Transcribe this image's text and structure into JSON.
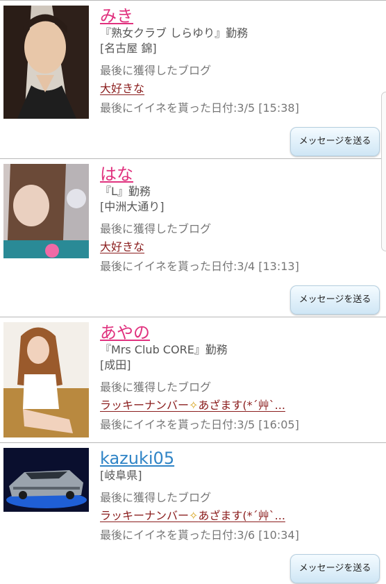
{
  "users": [
    {
      "name": "みき",
      "workplace": "『熟女クラブ しらゆり』勤務",
      "area": "[名古屋 錦]",
      "blog_heading": "最後に獲得したブログ",
      "blog_title": "大好きな",
      "like_date": "最後にイイネを貰った日付:3/5 [15:38]",
      "message_label": "メッセージを送る"
    },
    {
      "name": "はな",
      "workplace": "『L』勤務",
      "area": "[中洲大通り]",
      "blog_heading": "最後に獲得したブログ",
      "blog_title": "大好きな",
      "like_date": "最後にイイネを貰った日付:3/4 [13:13]",
      "message_label": "メッセージを送る"
    },
    {
      "name": "あやの",
      "workplace": "『Mrs Club CORE』勤務",
      "area": "[成田]",
      "blog_heading": "最後に獲得したブログ",
      "blog_title_a": "ラッキーナンバー",
      "blog_title_b": "あざます(*´艸`...",
      "like_date": "最後にイイネを貰った日付:3/5 [16:05]"
    },
    {
      "name": "kazuki05",
      "area": "[岐阜県]",
      "blog_heading": "最後に獲得したブログ",
      "blog_title_a": "ラッキーナンバー",
      "blog_title_b": "あざます(*´艸`...",
      "like_date": "最後にイイネを貰った日付:3/6 [10:34]",
      "message_label": "メッセージを送る"
    }
  ],
  "icons": {
    "sparkle": "✧"
  }
}
